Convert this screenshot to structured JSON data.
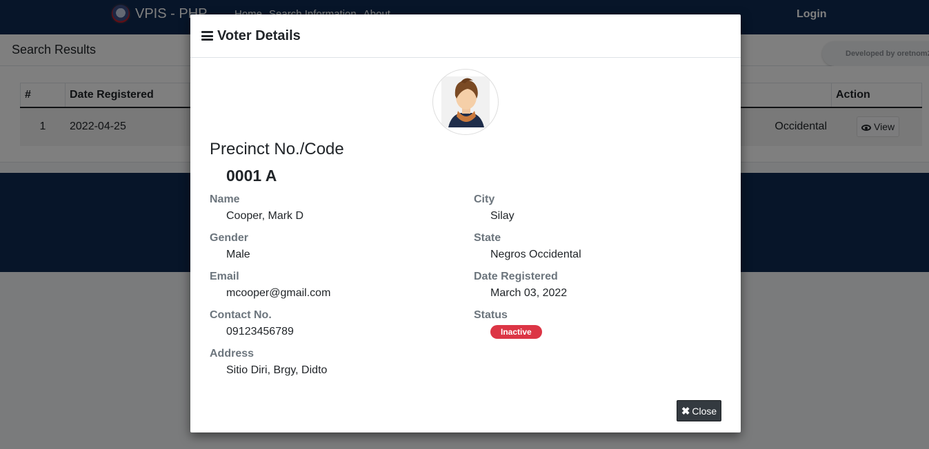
{
  "navbar": {
    "brand": "VPIS - PHP",
    "links": [
      "Home",
      "Search Information",
      "About"
    ],
    "login": "Login"
  },
  "results": {
    "title": "Search Results",
    "developer_badge": "Developed by oretnom2",
    "columns": {
      "num": "#",
      "date": "Date Registered",
      "action": "Action"
    },
    "rows": [
      {
        "num": "1",
        "date": "2022-04-25",
        "state_partial": "Occidental",
        "action_label": "View"
      }
    ]
  },
  "modal": {
    "title": "Voter Details",
    "precinct_label": "Precinct No./Code",
    "precinct_value": "0001 A",
    "fields": {
      "name": {
        "label": "Name",
        "value": "Cooper, Mark D"
      },
      "gender": {
        "label": "Gender",
        "value": "Male"
      },
      "email": {
        "label": "Email",
        "value": "mcooper@gmail.com"
      },
      "contact": {
        "label": "Contact No.",
        "value": "09123456789"
      },
      "address": {
        "label": "Address",
        "value": "Sitio Diri, Brgy, Didto"
      },
      "city": {
        "label": "City",
        "value": "Silay"
      },
      "state": {
        "label": "State",
        "value": "Negros Occidental"
      },
      "date_registered": {
        "label": "Date Registered",
        "value": "March 03, 2022"
      },
      "status": {
        "label": "Status",
        "value": "Inactive"
      }
    },
    "close_label": "Close"
  },
  "colors": {
    "navbar": "#0f2b52",
    "status_inactive": "#dc3545",
    "close_button": "#343a40"
  }
}
